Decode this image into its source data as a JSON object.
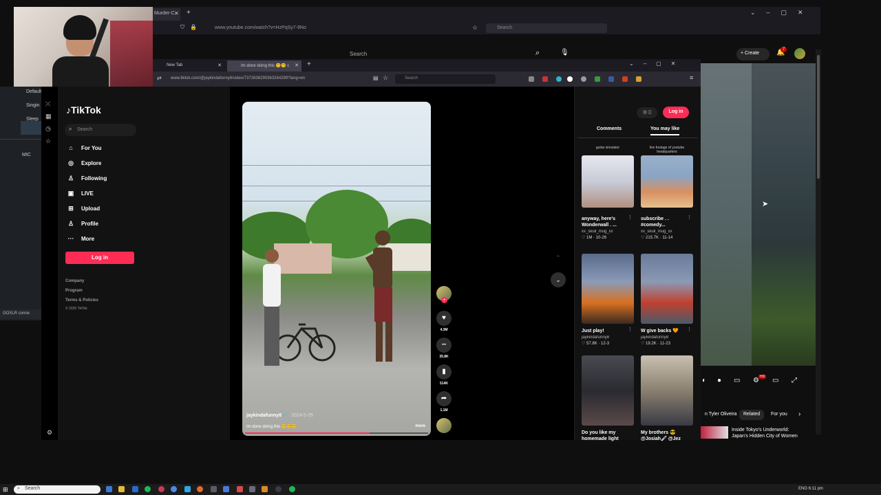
{
  "outer_browser": {
    "tab_label": "Murder-C",
    "url": "www.youtube.com/watch?v=HzPqSy7-9No",
    "search_placeholder": "Search"
  },
  "youtube": {
    "search_placeholder": "Search",
    "create_label": "Create",
    "notification_count": "7",
    "chips": [
      "n Tyler Oliveira",
      "Related",
      "For you"
    ],
    "rec_title": "Inside Tokyo's Underworld: Japan's Hidden City of Women",
    "hd_badge": "HD"
  },
  "obs": {
    "items": [
      "Default",
      "Singin",
      "Sleep",
      "MIC"
    ],
    "footer": "GOXLR conne"
  },
  "inner_browser": {
    "tabs": [
      {
        "label": "New Tab",
        "active": false
      },
      {
        "label": "Im done doing this 😵‍💫😵‍💫 c",
        "active": true
      }
    ],
    "url": "www.tiktok.com/@jaykindafunny8/video/7372636290363264299?lang=en",
    "search_placeholder": "Search"
  },
  "tiktok": {
    "logo": "TikTok",
    "search_placeholder": "Search",
    "nav": [
      {
        "icon": "home-icon",
        "glyph": "⌂",
        "label": "For You"
      },
      {
        "icon": "explore-icon",
        "glyph": "◎",
        "label": "Explore"
      },
      {
        "icon": "following-icon",
        "glyph": "♙",
        "label": "Following"
      },
      {
        "icon": "live-icon",
        "glyph": "▣",
        "label": "LIVE"
      },
      {
        "icon": "upload-icon",
        "glyph": "⊞",
        "label": "Upload"
      },
      {
        "icon": "profile-icon",
        "glyph": "♙",
        "label": "Profile"
      },
      {
        "icon": "more-icon",
        "glyph": "···",
        "label": "More"
      }
    ],
    "login_label": "Log in",
    "footer": [
      "Company",
      "Program",
      "Terms & Policies",
      "© 2025 TikTok"
    ],
    "video": {
      "username": "jaykindafunny8",
      "date": " · 2024-5-25",
      "caption": "Im done doing this 😵‍💫😵‍💫😵‍💫",
      "more_label": "more",
      "progress": 0.68
    },
    "actions": [
      {
        "icon": "heart-icon",
        "glyph": "♥",
        "count": "4.3M"
      },
      {
        "icon": "comment-icon",
        "glyph": "•••",
        "count": "35.8K"
      },
      {
        "icon": "bookmark-icon",
        "glyph": "▮",
        "count": "514K"
      },
      {
        "icon": "share-icon",
        "glyph": "➦",
        "count": "1.1M"
      }
    ],
    "right_panel": {
      "tabs": [
        "Comments",
        "You may like"
      ],
      "active_tab": "You may like",
      "login_label": "Log in",
      "cards": [
        {
          "tag": "guitar simulator",
          "title": "anyway, here's Wonderwall . ...",
          "author": "xx_skull_mug_xx",
          "likes": "♡ 1M · 10-26",
          "bg": "#c8ccd8"
        },
        {
          "tag": "live footage of youtube headquarters",
          "title": "subscribe . . #comedy...",
          "author": "xx_skull_mug_xx",
          "likes": "♡ 215.7K · 11-14",
          "bg": "#9aa8b8"
        },
        {
          "tag": "",
          "title": "Just play!",
          "author": "jaykindafunny8",
          "likes": "♡ 57.8K · 12-3",
          "bg": "#6a7894"
        },
        {
          "tag": "",
          "title": "W give backs 🧡",
          "author": "jaykindafunny8",
          "likes": "♡ 19.2K · 11-23",
          "bg": "#7a8aa8"
        },
        {
          "tag": "",
          "title": "Do you like my homemade light",
          "author": "",
          "likes": "",
          "bg": "#3a3a42"
        },
        {
          "tag": "",
          "title": "My brothers 😎 @Josiah🖌 @Jez",
          "author": "",
          "likes": "",
          "bg": "#b0a89a"
        }
      ]
    }
  },
  "taskbar": {
    "search_placeholder": "Search",
    "tray_text": "ENG   6:11 pm"
  }
}
